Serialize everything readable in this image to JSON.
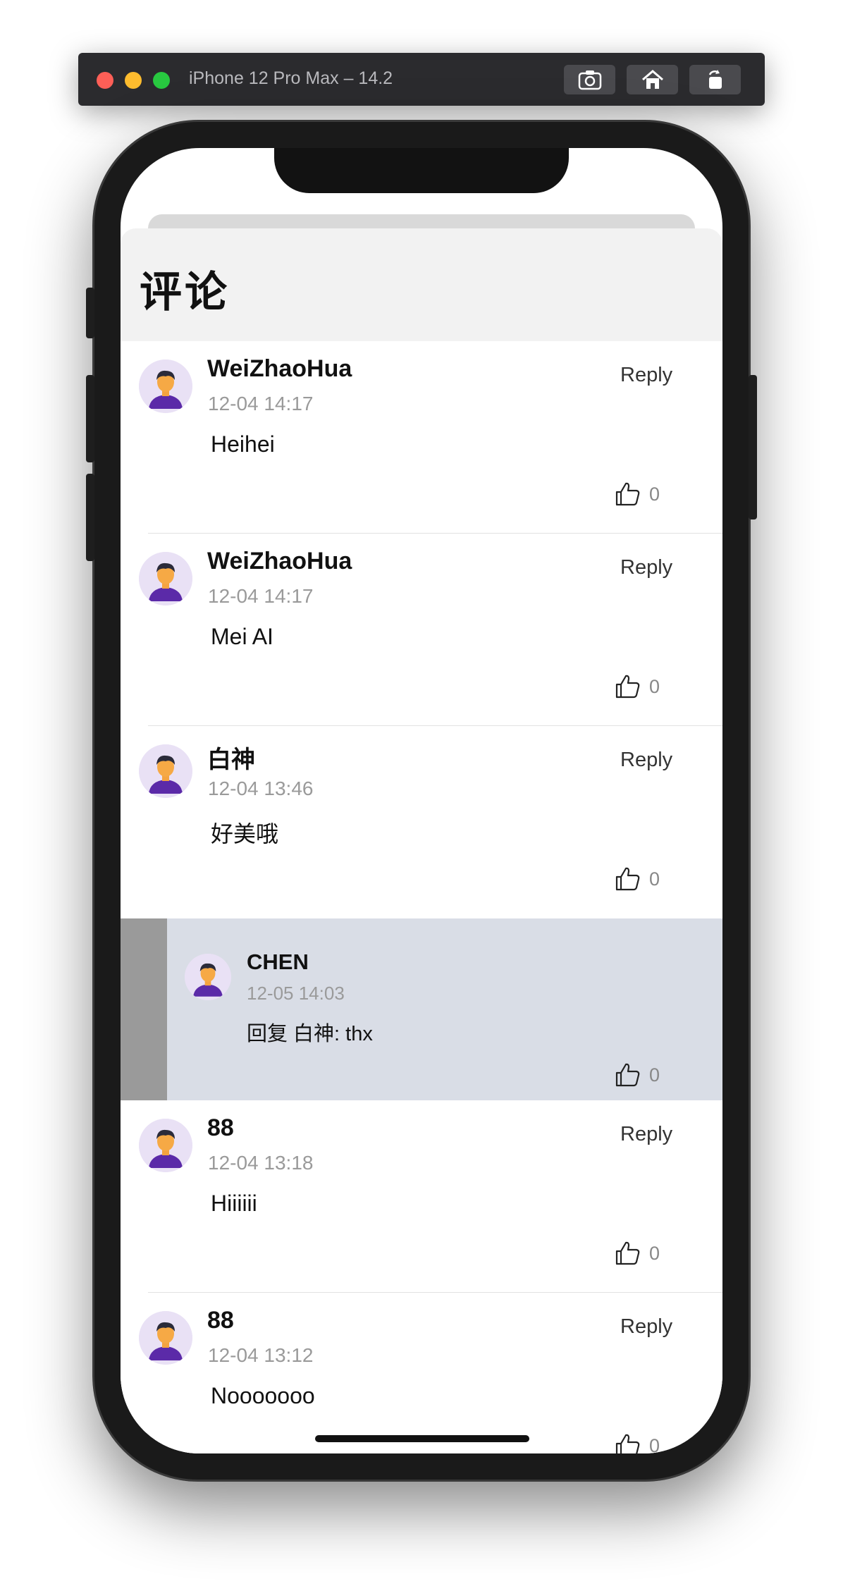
{
  "simulator": {
    "title": "iPhone 12 Pro Max – 14.2",
    "buttons": [
      "screenshot-icon",
      "home-icon",
      "rotate-icon"
    ]
  },
  "sheet": {
    "title": "评论"
  },
  "comments": [
    {
      "username": "WeiZhaoHua",
      "time": "12-04 14:17",
      "text": "Heihei",
      "reply_label": "Reply",
      "likes": "0"
    },
    {
      "username": "WeiZhaoHua",
      "time": "12-04 14:17",
      "text": "Mei AI",
      "reply_label": "Reply",
      "likes": "0"
    },
    {
      "username": "白神",
      "time": "12-04 13:46",
      "text": "好美哦",
      "reply_label": "Reply",
      "likes": "0"
    },
    {
      "username": "88",
      "time": "12-04 13:18",
      "text": "Hiiiiii",
      "reply_label": "Reply",
      "likes": "0"
    },
    {
      "username": "88",
      "time": "12-04 13:12",
      "text": "Nooooooo",
      "reply_label": "Reply",
      "likes": "0"
    }
  ],
  "reply": {
    "username": "CHEN",
    "time": "12-05 14:03",
    "text": "回复 白神: thx",
    "likes": "0"
  },
  "colors": {
    "header_bg": "#f2f2f2",
    "reply_bg": "#d9dde6",
    "reply_bar": "#9a9a9a",
    "timestamp": "#9a9a9a"
  }
}
